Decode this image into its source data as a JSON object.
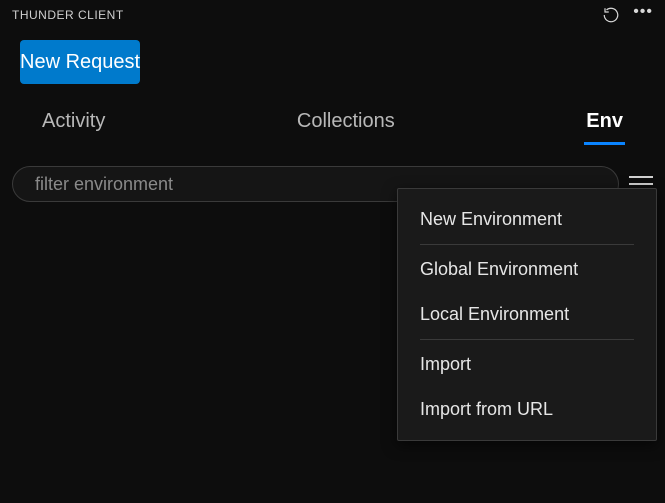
{
  "titlebar": {
    "title": "THUNDER CLIENT"
  },
  "primary_button": {
    "label": "New Request"
  },
  "tabs": {
    "activity": "Activity",
    "collections": "Collections",
    "env": "Env",
    "active": "env"
  },
  "filter": {
    "placeholder": "filter environment",
    "value": ""
  },
  "menu": {
    "new_env": "New Environment",
    "global_env": "Global Environment",
    "local_env": "Local Environment",
    "import": "Import",
    "import_url": "Import from URL"
  },
  "colors": {
    "accent": "#007acc"
  }
}
